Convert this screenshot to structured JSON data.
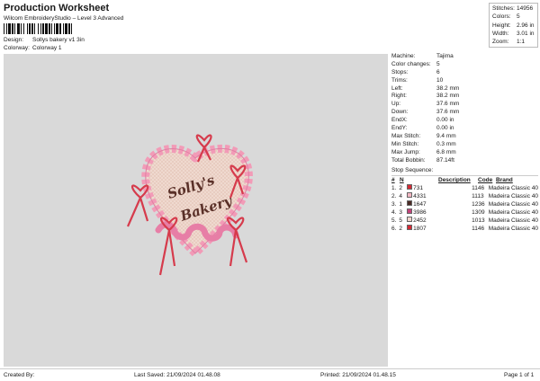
{
  "header": {
    "title": "Production Worksheet",
    "subtitle": "Wilcom EmbroideryStudio – Level 3 Advanced",
    "design_label": "Design:",
    "design_value": "Sollys bakery v1 3in",
    "colorway_label": "Colorway:",
    "colorway_value": "Colorway 1"
  },
  "summary": [
    {
      "label": "Stitches:",
      "value": "14956"
    },
    {
      "label": "Colors:",
      "value": "5"
    },
    {
      "label": "Height:",
      "value": "2.96 in"
    },
    {
      "label": "Width:",
      "value": "3.01 in"
    },
    {
      "label": "Zoom:",
      "value": "1:1"
    }
  ],
  "details": [
    {
      "label": "Machine:",
      "value": "Tajima"
    },
    {
      "label": "Color changes:",
      "value": "5"
    },
    {
      "label": "Stops:",
      "value": "6"
    },
    {
      "label": "Trims:",
      "value": "10"
    },
    {
      "label": "Left:",
      "value": "38.2 mm"
    },
    {
      "label": "Right:",
      "value": "38.2 mm"
    },
    {
      "label": "Up:",
      "value": "37.6 mm"
    },
    {
      "label": "Down:",
      "value": "37.6 mm"
    },
    {
      "label": "EndX:",
      "value": "0.00 in"
    },
    {
      "label": "EndY:",
      "value": "0.00 in"
    },
    {
      "label": "Max Stitch:",
      "value": "9.4 mm"
    },
    {
      "label": "Min Stitch:",
      "value": "0.3 mm"
    },
    {
      "label": "Max Jump:",
      "value": "6.8 mm"
    },
    {
      "label": "Total Bobbin:",
      "value": "87.14ft"
    }
  ],
  "stop_sequence": {
    "title": "Stop Sequence:",
    "headers": {
      "num": "#",
      "n": "N",
      "desc": "Description",
      "code": "Code",
      "brand": "Brand"
    },
    "rows": [
      {
        "num": "1.",
        "n": "2",
        "color": "#d42a35",
        "id": "731",
        "desc": "",
        "code": "1146",
        "brand": "Madeira Classic 40"
      },
      {
        "num": "2.",
        "n": "4",
        "color": "#f2b6c2",
        "id": "4331",
        "desc": "",
        "code": "1113",
        "brand": "Madeira Classic 40"
      },
      {
        "num": "3.",
        "n": "1",
        "color": "#4a2a24",
        "id": "1647",
        "desc": "",
        "code": "1236",
        "brand": "Madeira Classic 40"
      },
      {
        "num": "4.",
        "n": "3",
        "color": "#c2437a",
        "id": "3986",
        "desc": "",
        "code": "1309",
        "brand": "Madeira Classic 40"
      },
      {
        "num": "5.",
        "n": "5",
        "color": "#f0d6cc",
        "id": "2452",
        "desc": "",
        "code": "1013",
        "brand": "Madeira Classic 40"
      },
      {
        "num": "6.",
        "n": "2",
        "color": "#d42a35",
        "id": "1807",
        "desc": "",
        "code": "1146",
        "brand": "Madeira Classic 40"
      }
    ]
  },
  "design_text": {
    "line1": "Solly's",
    "line2": "Bakery"
  },
  "footer": {
    "created": "Created By:",
    "saved": "Last Saved: 21/09/2024 01.48.08",
    "printed": "Printed: 21/09/2024 01.48.15",
    "page": "Page 1 of 1"
  }
}
